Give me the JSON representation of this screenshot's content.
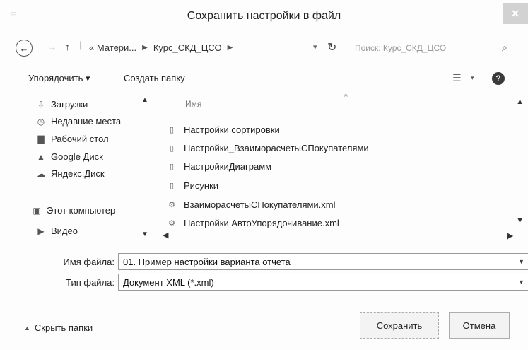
{
  "window": {
    "title": "Сохранить настройки в файл",
    "close": "×"
  },
  "address": {
    "crumbs": [
      "« Матери...",
      "Курс_СКД_ЦСО"
    ],
    "search_placeholder": "Поиск: Курс_СКД_ЦСО"
  },
  "toolbar": {
    "organize": "Упорядочить ▾",
    "new_folder": "Создать папку"
  },
  "navpane": {
    "items": [
      {
        "label": "Загрузки",
        "icon": "downloads-icon"
      },
      {
        "label": "Недавние места",
        "icon": "recent-places-icon"
      },
      {
        "label": "Рабочий стол",
        "icon": "desktop-icon"
      },
      {
        "label": "Google Диск",
        "icon": "google-drive-icon"
      },
      {
        "label": "Яндекс.Диск",
        "icon": "yandex-disk-icon"
      },
      {
        "label": "Этот компьютер",
        "icon": "computer-icon"
      },
      {
        "label": "Видео",
        "icon": "video-icon"
      }
    ]
  },
  "filelist": {
    "column_name": "Имя",
    "files": [
      {
        "name": "Настройки сортировки",
        "icon": "folder-icon"
      },
      {
        "name": "Настройки_ВзаиморасчетыСПокупателями",
        "icon": "folder-icon"
      },
      {
        "name": "НастройкиДиаграмм",
        "icon": "folder-icon"
      },
      {
        "name": "Рисунки",
        "icon": "folder-icon"
      },
      {
        "name": "ВзаиморасчетыСПокупателями.xml",
        "icon": "xml-file-icon"
      },
      {
        "name": "Настройки АвтоУпорядочивание.xml",
        "icon": "xml-file-icon"
      }
    ]
  },
  "fields": {
    "filename_label": "Имя файла:",
    "filename_value": "01. Пример настройки варианта отчета",
    "filetype_label": "Тип файла:",
    "filetype_value": "Документ XML (*.xml)"
  },
  "bottom": {
    "hide_folders": "Скрыть папки",
    "save": "Сохранить",
    "cancel": "Отмена"
  }
}
